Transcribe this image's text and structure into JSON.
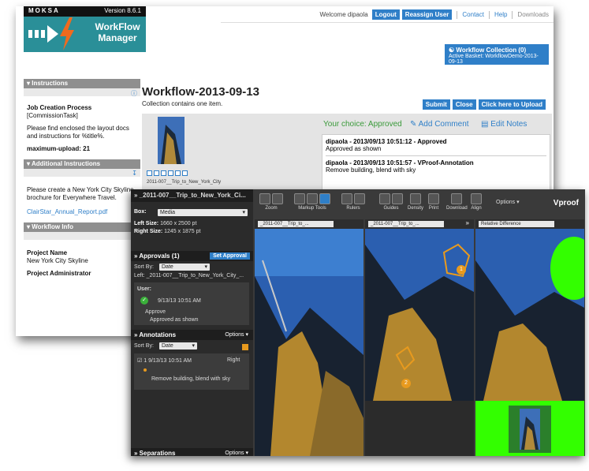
{
  "logo": {
    "brand": "MOKSA",
    "version": "Version 8.6.1",
    "title_line1": "WorkFlow",
    "title_line2": "Manager"
  },
  "nav": {
    "welcome": "Welcome dipaola",
    "logout": "Logout",
    "reassign": "Reassign User",
    "contact": "Contact",
    "help": "Help",
    "downloads": "Downloads"
  },
  "collection": {
    "title": "Workflow Collection (0)",
    "basket": "Active Basket: WorkflowDemo-2013-09-13"
  },
  "sidebar": {
    "instructions_header": "Instructions",
    "job_process": "Job Creation Process",
    "commission": "[CommissionTask]",
    "instructions_text": "Please find enclosed the layout docs and instructions for %title%.",
    "max_upload": "maximum-upload: 21",
    "additional_header": "Additional Instructions",
    "additional_text": "Please create a New York City Skyline brochure for Everywhere Travel.",
    "report_link": "ClairStar_Annual_Report.pdf",
    "wfinfo_header": "Workflow Info",
    "project_name_label": "Project Name",
    "project_name_value": "New York City Skyline",
    "project_admin_label": "Project Administrator"
  },
  "main": {
    "title": "Workflow-2013-09-13",
    "subtitle": "Collection contains one item.",
    "submit": "Submit",
    "close": "Close",
    "upload": "Click here to Upload",
    "choice": "Your choice: Approved",
    "add_comment": "Add Comment",
    "edit_notes": "Edit Notes",
    "thumb_caption": "2011-007__Trip_to_New_York_City",
    "note1_header": "dipaola - 2013/09/13 10:51:12 - Approved",
    "note1_body": "Approved as shown",
    "note2_header": "dipaola - 2013/09/13 10:51:57 - VProof-Annotation",
    "note2_body": "Remove building, blend with sky"
  },
  "viewer": {
    "file_title": "_2011-007__Trip_to_New_York_Ci...",
    "box_label": "Box:",
    "box_value": "Media",
    "left_size_label": "Left Size:",
    "left_size_value": "1660 x 2500 pt",
    "right_size_label": "Right Size:",
    "right_size_value": "1245 x 1875 pt",
    "approvals_header": "Approvals (1)",
    "set_approval": "Set Approval",
    "sort_by": "Sort By:",
    "sort_value": "Date",
    "left_file": "Left: _2011-007__Trip_to_New_York_City_...",
    "user_label": "User:",
    "approval_time": "9/13/13 10:51 AM",
    "approve": "Approve",
    "approved_as_shown": "Approved as shown",
    "annotations_header": "Annotations",
    "options": "Options",
    "annotation_item": "1 9/13/13 10:51 AM",
    "annotation_side": "Right",
    "annotation_text": "Remove building, blend with sky",
    "separations_header": "Separations",
    "tool_zoom": "Zoom",
    "tool_markup": "Markup Tools",
    "tool_rulers": "Rulers",
    "tool_guides": "Guides",
    "tool_density": "Density",
    "tool_print": "Print",
    "tool_download": "Download",
    "tool_align": "Align",
    "brand": "Vproof",
    "pane1_file": "_2011-007__Trip_to_...",
    "pane2_file": "_2011-007__Trip_to_...",
    "pane3_mode": "Relative Difference",
    "marker1": "1",
    "marker2": "2"
  },
  "colors": {
    "brand_teal": "#2a8f98",
    "accent_blue": "#2f7fc8",
    "approved_green": "#3a9a3a",
    "marker_orange": "#e89a1e",
    "diff_green": "#33ff00"
  }
}
